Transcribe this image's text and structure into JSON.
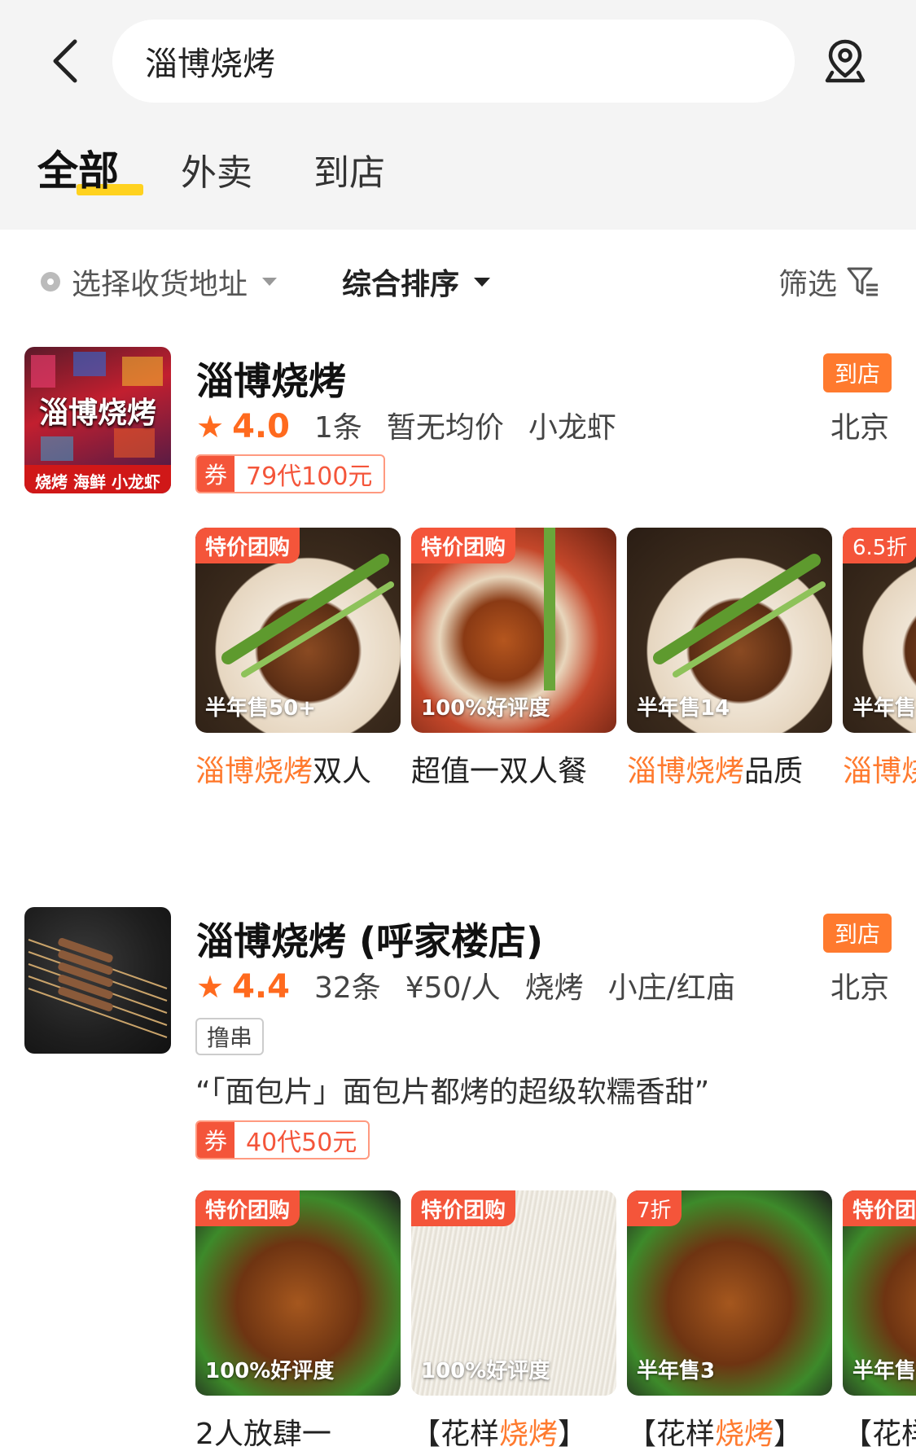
{
  "search": {
    "query": "淄博烧烤"
  },
  "tabs": [
    {
      "label": "全部",
      "active": true
    },
    {
      "label": "外卖",
      "active": false
    },
    {
      "label": "到店",
      "active": false
    }
  ],
  "filters": {
    "address": "选择收货地址",
    "sort": "综合排序",
    "filter": "筛选"
  },
  "colors": {
    "accent": "#ff7a2e",
    "coupon": "#f4553a",
    "tab_underline": "#ffd21f"
  },
  "shops": [
    {
      "name": "淄博烧烤",
      "badge": "到店",
      "city": "北京",
      "rating": "4.0",
      "reviews": "1条",
      "price": "暂无均价",
      "category": "小龙虾",
      "coupon": "79代100元",
      "coupon_mark": "券",
      "thumb_text": [
        "淄博烧烤",
        "烧烤 海鲜 小龙虾"
      ],
      "deals": [
        {
          "badge": "特价团购",
          "sales": "半年售50+",
          "title_hl": "淄博烧烤",
          "title_rest": "双人"
        },
        {
          "badge": "特价团购",
          "sales": "100%好评度",
          "title_hl": "",
          "title_rest": "超值一双人餐"
        },
        {
          "badge": "",
          "sales": "半年售14",
          "title_hl": "淄博烧烤",
          "title_rest": "品质"
        },
        {
          "badge": "6.5折",
          "sales": "半年售",
          "title_hl": "淄博烧",
          "title_rest": ""
        }
      ]
    },
    {
      "name": "淄博烧烤 (呼家楼店)",
      "badge": "到店",
      "city": "北京",
      "rating": "4.4",
      "reviews": "32条",
      "price": "¥50/人",
      "category": "烧烤",
      "area": "小庄/红庙",
      "tag": "撸串",
      "review": "“「面包片」面包片都烤的超级软糯香甜”",
      "coupon": "40代50元",
      "coupon_mark": "券",
      "deals": [
        {
          "badge": "特价团购",
          "sales": "100%好评度",
          "title_hl": "",
          "title_rest": "2人放肆一"
        },
        {
          "badge": "特价团购",
          "sales": "100%好评度",
          "title_pre": "【花样",
          "title_hl": "烧烤",
          "title_rest": "】"
        },
        {
          "badge": "7折",
          "sales": "半年售3",
          "title_pre": "【花样",
          "title_hl": "烧烤",
          "title_rest": "】"
        },
        {
          "badge": "特价团",
          "sales": "半年售",
          "title_pre": "【花样",
          "title_hl": "",
          "title_rest": ""
        }
      ]
    }
  ]
}
